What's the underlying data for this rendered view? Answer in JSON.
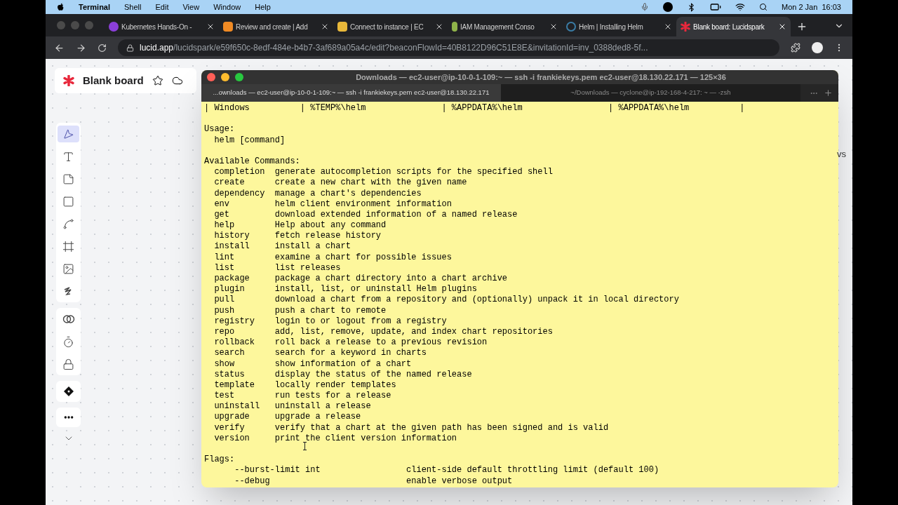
{
  "menu_bar": {
    "app": "Terminal",
    "menus": [
      "Shell",
      "Edit",
      "View",
      "Window",
      "Help"
    ],
    "clock": "Mon 2 Jan  16:03"
  },
  "browser": {
    "tabs": [
      {
        "title": "Kubernetes Hands-On -",
        "kind": "course",
        "selected": false
      },
      {
        "title": "Review and create | Add",
        "kind": "cube",
        "selected": false
      },
      {
        "title": "Connect to instance | EC",
        "kind": "box",
        "selected": false
      },
      {
        "title": "IAM Management Conso",
        "kind": "key",
        "selected": false
      },
      {
        "title": "Helm | Installing Helm",
        "kind": "helm",
        "selected": false
      },
      {
        "title": "Blank board: Lucidspark",
        "kind": "lucid",
        "selected": true
      }
    ],
    "url_host": "lucid.app",
    "url_path": "/lucidspark/e59f650c-8edf-484e-b4b7-3af689a05a4c/edit?beaconFlowId=40B8122D96C51E8E&invitationId=inv_0388ded8-5f..."
  },
  "board": {
    "title": "Blank board",
    "side_text": "vs",
    "tools": [
      {
        "kind": "select",
        "selected": true
      },
      {
        "kind": "text",
        "selected": false
      },
      {
        "kind": "sticky",
        "selected": false
      },
      {
        "kind": "shape",
        "selected": false
      },
      {
        "kind": "line",
        "selected": false
      },
      {
        "kind": "frame",
        "selected": false
      },
      {
        "kind": "image",
        "selected": false
      },
      {
        "kind": "draw",
        "selected": false
      }
    ],
    "extra_tools": [
      {
        "kind": "circles"
      },
      {
        "kind": "timer"
      },
      {
        "kind": "lock"
      }
    ]
  },
  "terminal": {
    "title": "Downloads — ec2-user@ip-10-0-1-109:~ — ssh -i frankiekeys.pem ec2-user@18.130.22.171 — 125×36",
    "tabs": [
      {
        "title": "...ownloads — ec2-user@ip-10-0-1-109:~ — ssh -i frankiekeys.pem ec2-user@18.130.22.171",
        "selected": true
      },
      {
        "title": "~/Downloads — cyclone@ip-192-168-4-217: ~ — -zsh",
        "selected": false
      }
    ],
    "table_row": "| Windows          | %TEMP%\\helm               | %APPDATA%\\helm                 | %APPDATA%\\helm          |",
    "usage_heading": "Usage:",
    "usage": "  helm [command]",
    "commands_heading": "Available Commands:",
    "commands": [
      {
        "name": "completion",
        "description": "generate autocompletion scripts for the specified shell"
      },
      {
        "name": "create",
        "description": "create a new chart with the given name"
      },
      {
        "name": "dependency",
        "description": "manage a chart's dependencies"
      },
      {
        "name": "env",
        "description": "helm client environment information"
      },
      {
        "name": "get",
        "description": "download extended information of a named release"
      },
      {
        "name": "help",
        "description": "Help about any command"
      },
      {
        "name": "history",
        "description": "fetch release history"
      },
      {
        "name": "install",
        "description": "install a chart"
      },
      {
        "name": "lint",
        "description": "examine a chart for possible issues"
      },
      {
        "name": "list",
        "description": "list releases"
      },
      {
        "name": "package",
        "description": "package a chart directory into a chart archive"
      },
      {
        "name": "plugin",
        "description": "install, list, or uninstall Helm plugins"
      },
      {
        "name": "pull",
        "description": "download a chart from a repository and (optionally) unpack it in local directory"
      },
      {
        "name": "push",
        "description": "push a chart to remote"
      },
      {
        "name": "registry",
        "description": "login to or logout from a registry"
      },
      {
        "name": "repo",
        "description": "add, list, remove, update, and index chart repositories"
      },
      {
        "name": "rollback",
        "description": "roll back a release to a previous revision"
      },
      {
        "name": "search",
        "description": "search for a keyword in charts"
      },
      {
        "name": "show",
        "description": "show information of a chart"
      },
      {
        "name": "status",
        "description": "display the status of the named release"
      },
      {
        "name": "template",
        "description": "locally render templates"
      },
      {
        "name": "test",
        "description": "run tests for a release"
      },
      {
        "name": "uninstall",
        "description": "uninstall a release"
      },
      {
        "name": "upgrade",
        "description": "upgrade a release"
      },
      {
        "name": "verify",
        "description": "verify that a chart at the given path has been signed and is valid"
      },
      {
        "name": "version",
        "description": "print the client version information"
      }
    ],
    "flags_heading": "Flags:",
    "flags": [
      {
        "name": "--burst-limit int",
        "description": "client-side default throttling limit (default 100)"
      },
      {
        "name": "--debug",
        "description": "enable verbose output"
      }
    ]
  }
}
